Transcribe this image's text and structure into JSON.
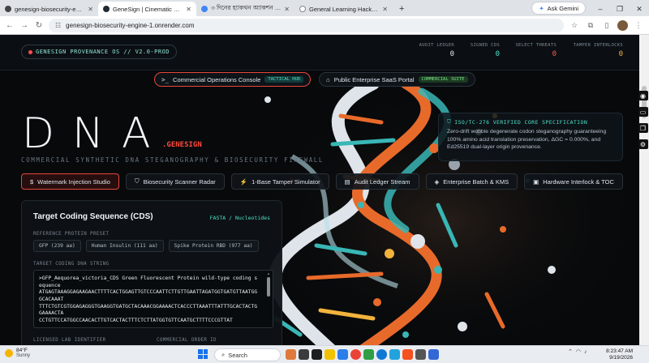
{
  "browser": {
    "tabs": [
      {
        "title": "genesign-biosecurity-engine-1",
        "active": false
      },
      {
        "title": "GeneSign | Cinematic 3D Synth",
        "active": true
      },
      {
        "title": "৩ দিনের হ্যাকথন অ্যাকশন প্ল্যান",
        "active": false
      },
      {
        "title": "General Learning Hacks: Acceler",
        "active": false
      }
    ],
    "new_tab": "+",
    "ask_gemini": "Ask Gemini",
    "url": "genesign-biosecurity-engine-1.onrender.com"
  },
  "header": {
    "brand": "GENESIGN PROVENANCE OS // V2.0-PROD",
    "stats": [
      {
        "label": "AUDIT LEDGER",
        "value": "0",
        "color": "#e6ebf0"
      },
      {
        "label": "SIGNED CDS",
        "value": "0",
        "color": "#4de0c8"
      },
      {
        "label": "SELECT THREATS",
        "value": "0",
        "color": "#ff5a4d"
      },
      {
        "label": "TAMPER INTERLOCKS",
        "value": "0",
        "color": "#f4b63b"
      }
    ]
  },
  "modes": [
    {
      "label": "Commercial Operations Console",
      "tag": "TACTICAL HUD",
      "icon": ">_",
      "active": true
    },
    {
      "label": "Public Enterprise SaaS Portal",
      "tag": "COMMERCIAL SUITE",
      "icon": "⌂",
      "active": false
    }
  ],
  "hero": {
    "title": "DNA",
    "tag": ".GENESIGN",
    "subtitle": "COMMERCIAL SYNTHETIC DNA STEGANOGRAPHY & BIOSECURITY FIREWALL"
  },
  "spec": {
    "title": "ISO/TC-276 VERIFIED CORE SPECIFICATION",
    "body": "Zero-drift wobble degenerate codon steganography guaranteeing 100% amino acid translation preservation, ΔGC = 0.000%, and Ed25519 dual-layer origin provenance."
  },
  "tools": [
    {
      "label": "Watermark Injection Studio",
      "icon": "$",
      "active": true
    },
    {
      "label": "Biosecurity Scanner Radar",
      "icon": "⛉",
      "active": false
    },
    {
      "label": "1-Base Tamper Simulator",
      "icon": "⚡",
      "active": false
    },
    {
      "label": "Audit Ledger Stream",
      "icon": "▤",
      "active": false
    },
    {
      "label": "Enterprise Batch & KMS",
      "icon": "◈",
      "active": false
    },
    {
      "label": "Hardware Interlock & TOC",
      "icon": "▣",
      "active": false
    }
  ],
  "panel": {
    "title": "Target Coding Sequence (CDS)",
    "format": "FASTA / Nucleotides",
    "preset_label": "REFERENCE PROTEIN PRESET",
    "presets": [
      "GFP (239 aa)",
      "Human Insulin (111 aa)",
      "Spike Protein RBD (977 aa)"
    ],
    "dna_label": "TARGET CODING DNA STRING",
    "dna_value": ">GFP_Aequorea_victoria_CDS Green Fluorescent Protein wild-type coding sequence\nATGAGTAAAGGAGAAGAACTTTTCACTGGAGTTGTCCCAATTCTTGTTGAATTAGATGGTGATGTTAATGGGCACAAAT\nTTTCTGTCGTGGAGAGGGTGAAGGTGATGCTACAAACGGAAAACTCACCCTTAAATTTATTTGCACTACTGGAAAACTA\nCCTGTTCCATGGCCAACACTTGTCACTACTTTCTCTTATGGTGTTCAATGCTTTTCCCGTTAT",
    "lab_label": "LICENSED LAB IDENTIFIER",
    "order_label": "COMMERCIAL ORDER ID"
  },
  "taskbar": {
    "temp": "84°F",
    "weather": "Sunny",
    "search": "Search",
    "time": "8:23:47 AM",
    "date": "9/19/2026"
  },
  "colors": {
    "accent_red": "#e4473c",
    "accent_teal": "#4de0c8",
    "background": "#07090b"
  }
}
